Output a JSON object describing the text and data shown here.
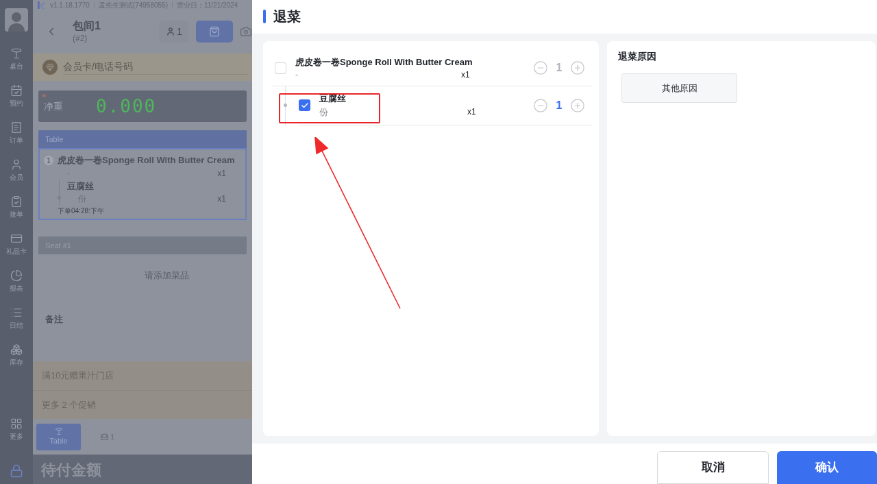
{
  "app": {
    "version": "v1.1.18.1770",
    "store": "孟先生测试(74958055)",
    "business_date": "营业日：11/21/2024"
  },
  "sidebar": {
    "items": [
      {
        "label": "桌台"
      },
      {
        "label": "预约"
      },
      {
        "label": "订单"
      },
      {
        "label": "会员"
      },
      {
        "label": "接单"
      },
      {
        "label": "礼品卡"
      },
      {
        "label": "报表"
      },
      {
        "label": "日结"
      },
      {
        "label": "库存"
      },
      {
        "label": "更多"
      }
    ]
  },
  "order": {
    "title": "包间1",
    "number": "(#2)",
    "guests": "1",
    "member_placeholder": "会员卡/电话号码",
    "scale": {
      "label": "净重",
      "reading": "0.000"
    },
    "table_section": {
      "header": "Table",
      "items": [
        {
          "index": "1",
          "name": "虎皮卷一卷Sponge Roll With Butter Cream",
          "spec": "-",
          "qty": "x1",
          "children": [
            {
              "name": "豆腐丝",
              "spec": "份",
              "qty": "x1"
            }
          ]
        }
      ],
      "time": "下单04:28:下午"
    },
    "seat_section": {
      "header": "Seat #1",
      "empty_text": "请添加菜品"
    },
    "note_label": "备注",
    "promotions": [
      "满10元赠果汁门店",
      "更多 2 个促销"
    ],
    "tabs": [
      {
        "kind": "table",
        "label": "Table",
        "selected": true
      },
      {
        "kind": "seat",
        "label": "1",
        "selected": false
      }
    ],
    "total_label": "待付金额"
  },
  "dialog": {
    "title": "退菜",
    "items": [
      {
        "name": "虎皮卷一卷Sponge Roll With Butter Cream",
        "spec": "-",
        "qty": "x1",
        "checked": false,
        "count": "1",
        "children": [
          {
            "name": "豆腐丝",
            "spec": "份",
            "qty": "x1",
            "checked": true,
            "count": "1"
          }
        ]
      }
    ],
    "reason_title": "退菜原因",
    "reasons": [
      {
        "label": "其他原因",
        "selected": false
      }
    ],
    "buttons": [
      {
        "label": "取消",
        "kind": "secondary"
      },
      {
        "label": "确认",
        "kind": "primary"
      }
    ]
  }
}
